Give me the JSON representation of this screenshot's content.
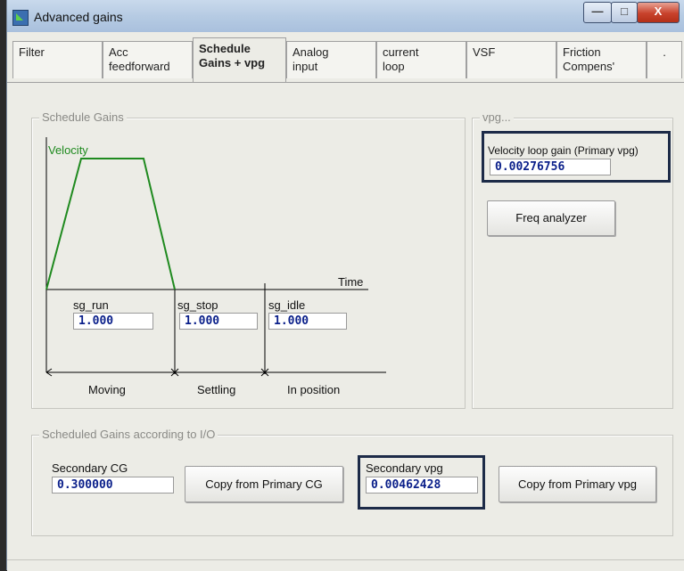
{
  "window": {
    "title": "Advanced gains"
  },
  "titlebar": {
    "minimize": "—",
    "maximize": "□",
    "close": "X"
  },
  "tabs": [
    {
      "line1": "Filter",
      "line2": ""
    },
    {
      "line1": "Acc",
      "line2": "feedforward"
    },
    {
      "line1": "Schedule",
      "line2": "Gains + vpg"
    },
    {
      "line1": "Analog",
      "line2": "input"
    },
    {
      "line1": "current",
      "line2": "loop"
    },
    {
      "line1": "VSF",
      "line2": ""
    },
    {
      "line1": "Friction",
      "line2": "Compens'"
    },
    {
      "line1": ".",
      "line2": ""
    }
  ],
  "schedule_gains": {
    "group_label": "Schedule Gains",
    "velocity_label": "Velocity",
    "time_label": "Time",
    "sg_run": {
      "label": "sg_run",
      "value": "1.000"
    },
    "sg_stop": {
      "label": "sg_stop",
      "value": "1.000"
    },
    "sg_idle": {
      "label": "sg_idle",
      "value": "1.000"
    },
    "phases": {
      "moving": "Moving",
      "settling": "Settling",
      "in_position": "In position"
    }
  },
  "vpg": {
    "group_label": "vpg...",
    "velocity_loop_gain_label": "Velocity loop gain (Primary vpg)",
    "velocity_loop_gain_value": "0.00276756",
    "freq_analyzer_label": "Freq analyzer"
  },
  "scheduled_io": {
    "group_label": "Scheduled Gains according to I/O",
    "secondary_cg_label": "Secondary CG",
    "secondary_cg_value": "0.300000",
    "copy_cg_label": "Copy from Primary CG",
    "secondary_vpg_label": "Secondary vpg",
    "secondary_vpg_value": "0.00462428",
    "copy_vpg_label": "Copy from Primary vpg"
  },
  "colors": {
    "velocity_curve": "#1f8a1f",
    "field_text": "#0a1f8a",
    "highlight_box": "#1d2b48"
  }
}
